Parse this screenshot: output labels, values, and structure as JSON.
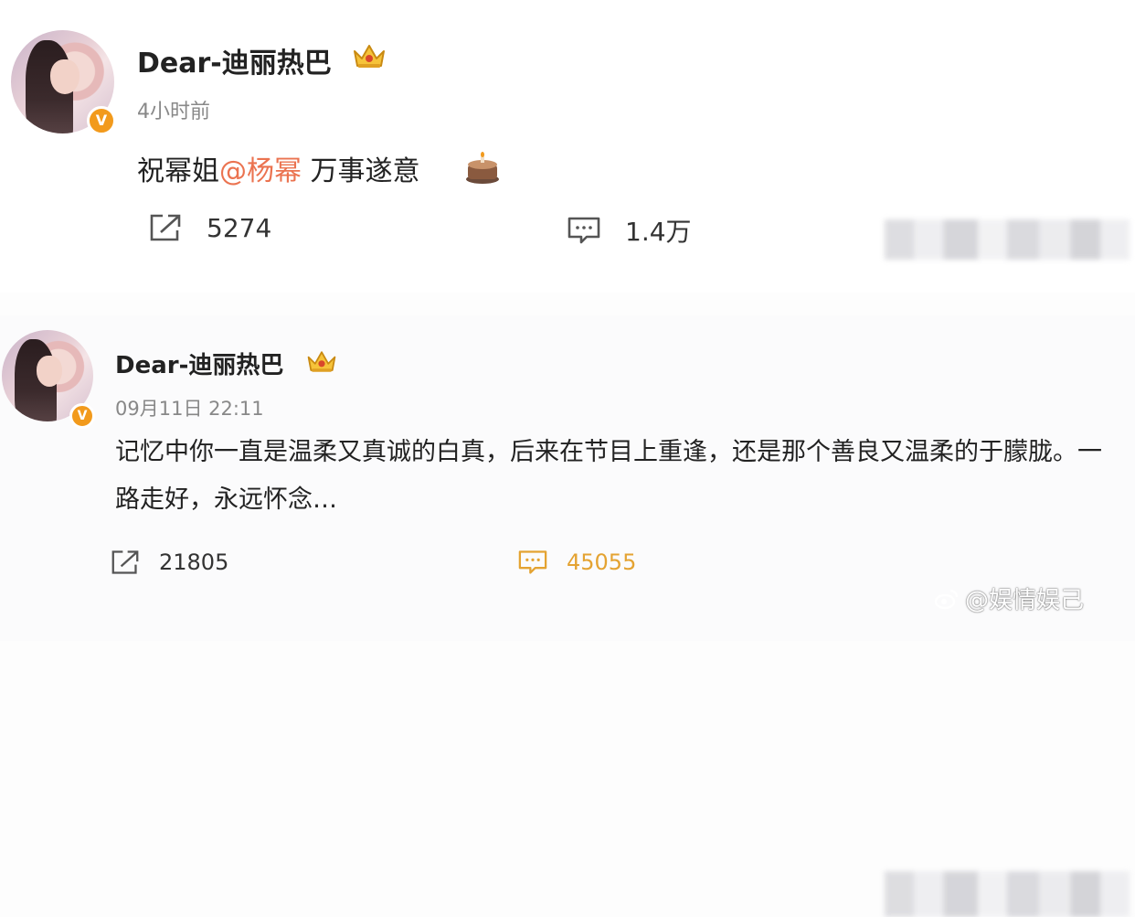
{
  "posts": [
    {
      "username": "Dear-迪丽热巴",
      "timestamp": "4小时前",
      "content": {
        "prefix": "祝幂姐",
        "mention": "@杨幂",
        "suffix": " 万事遂意"
      },
      "actions": {
        "repost_count": "5274",
        "comment_count": "1.4万"
      },
      "icons": [
        "avatar",
        "verified-badge-icon",
        "crown-icon",
        "cake-emoji-icon",
        "repost-icon",
        "comment-icon"
      ]
    },
    {
      "username": "Dear-迪丽热巴",
      "timestamp": "09月11日 22:11",
      "content": "记忆中你一直是温柔又真诚的白真，后来在节目上重逢，还是那个善良又温柔的于朦胧。一路走好，永远怀念…",
      "actions": {
        "repost_count": "21805",
        "comment_count": "45055"
      },
      "icons": [
        "avatar",
        "verified-badge-icon",
        "crown-icon",
        "repost-icon",
        "comment-icon"
      ]
    }
  ],
  "watermark": "@娱情娱己",
  "colors": {
    "mention": "#eb7350",
    "verified_badge": "#f29a1c",
    "active_comment": "#e4a332",
    "timestamp": "#888888"
  }
}
